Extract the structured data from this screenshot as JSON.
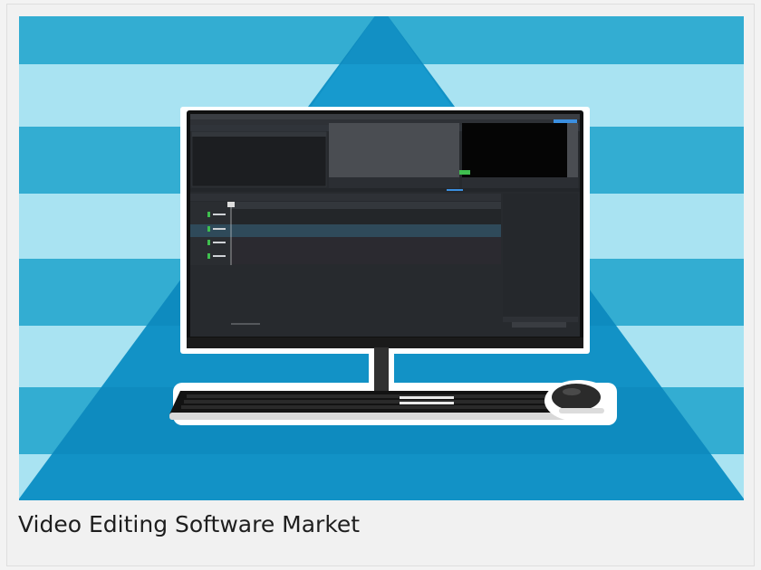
{
  "card": {
    "caption": "Video Editing Software Market"
  },
  "colors": {
    "stripe_light": "#a9e3f2",
    "stripe_dark": "#4ac6e3",
    "pyramid": "#1292c6",
    "pyramid_shadow": "#0a7fb3",
    "monitor_bezel": "#101010",
    "screen_bg": "#272a2e",
    "timeline_highlight": "#2f4a5a",
    "accent_blue": "#3b8fe0",
    "accent_green": "#3fbf4f",
    "caption_text": "#1e1e1e"
  },
  "icons": [
    "monitor-icon",
    "keyboard-icon",
    "mouse-icon"
  ]
}
